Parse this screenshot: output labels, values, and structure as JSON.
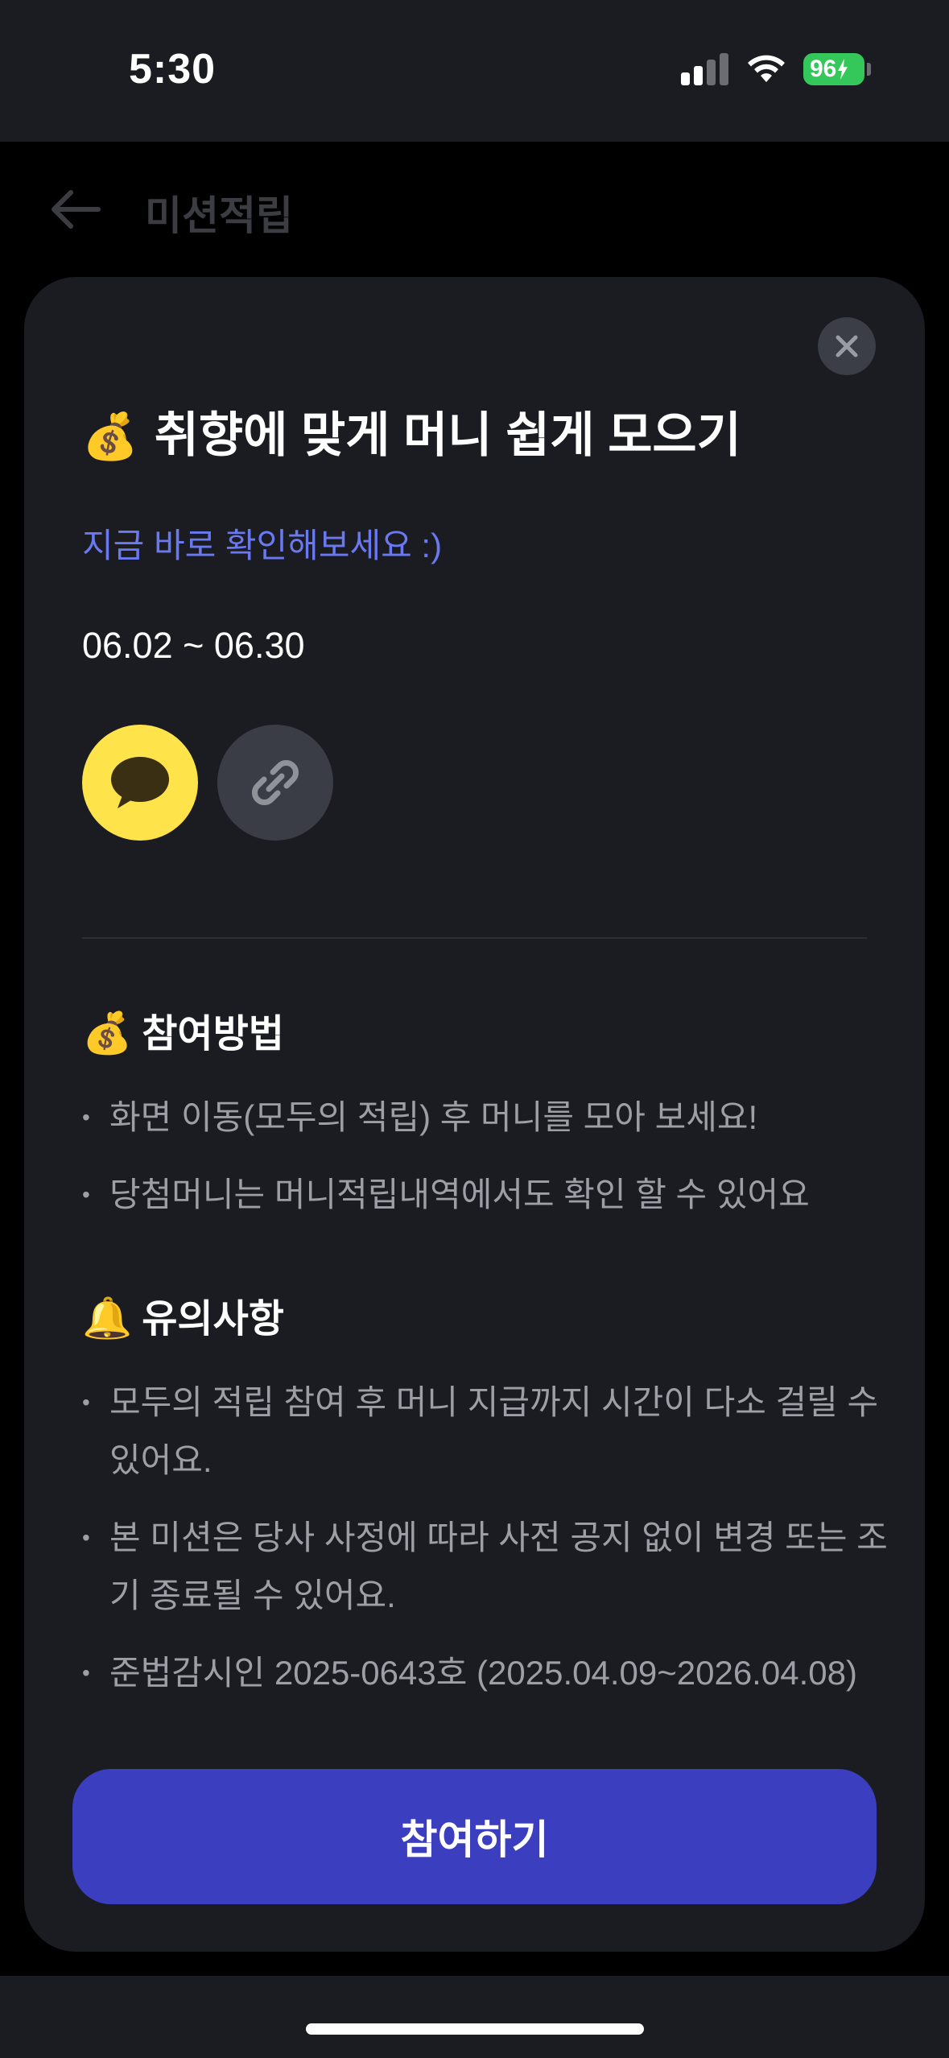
{
  "status_bar": {
    "time": "5:30",
    "battery": "96"
  },
  "page": {
    "title": "미션적립"
  },
  "modal": {
    "title_emoji": "💰",
    "title": "취향에 맞게 머니 쉽게 모으기",
    "subtitle": "지금 바로 확인해보세요 :)",
    "period": "06.02 ~ 06.30",
    "share": {
      "kakao_icon": "kakao-speech-bubble-icon",
      "link_icon": "link-chain-icon"
    },
    "how_to": {
      "emoji": "💰",
      "title": "참여방법",
      "items": [
        "화면 이동(모두의 적립) 후 머니를 모아 보세요!",
        "당첨머니는 머니적립내역에서도 확인 할 수 있어요"
      ]
    },
    "notice": {
      "emoji": "🔔",
      "title": "유의사항",
      "items": [
        "모두의 적립 참여 후 머니 지급까지 시간이 다소 걸릴 수 있어요.",
        "본 미션은 당사 사정에 따라 사전 공지 없이 변경 또는 조기 종료될 수 있어요.",
        "준법감시인 2025-0643호 (2025.04.09~2026.04.08)"
      ]
    },
    "join_label": "참여하기"
  },
  "colors": {
    "accent": "#3b3fbf",
    "subtitle": "#6a79f0",
    "kakao": "#fee34a",
    "battery": "#34c759"
  }
}
